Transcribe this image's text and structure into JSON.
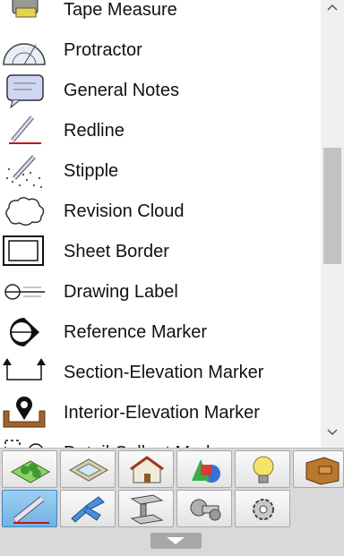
{
  "list": {
    "items": [
      {
        "label": "Tape Measure",
        "icon": "tape-measure-icon"
      },
      {
        "label": "Protractor",
        "icon": "protractor-icon"
      },
      {
        "label": "General Notes",
        "icon": "general-notes-icon"
      },
      {
        "label": "Redline",
        "icon": "redline-icon"
      },
      {
        "label": "Stipple",
        "icon": "stipple-icon"
      },
      {
        "label": "Revision Cloud",
        "icon": "revision-cloud-icon"
      },
      {
        "label": "Sheet Border",
        "icon": "sheet-border-icon"
      },
      {
        "label": "Drawing Label",
        "icon": "drawing-label-icon"
      },
      {
        "label": "Reference Marker",
        "icon": "reference-marker-icon"
      },
      {
        "label": "Section-Elevation Marker",
        "icon": "section-elevation-marker-icon"
      },
      {
        "label": "Interior-Elevation Marker",
        "icon": "interior-elevation-marker-icon"
      },
      {
        "label": "Detail Callout Marker",
        "icon": "detail-callout-marker-icon"
      }
    ]
  },
  "toolbar": {
    "row1": [
      "site-icon",
      "floor-slab-icon",
      "house-icon",
      "shapes-icon",
      "light-bulb-icon",
      "cabinet-icon"
    ],
    "row2": [
      "annotation-pencil-icon",
      "pipe-fitting-icon",
      "steel-beam-icon",
      "bolt-icon",
      "gear-icon"
    ],
    "selected": "annotation-pencil-icon"
  },
  "colors": {
    "selected_tool": "#7fbde9",
    "toolbar_bg": "#d9d9d9",
    "scroll_thumb": "#c2c2c2"
  }
}
